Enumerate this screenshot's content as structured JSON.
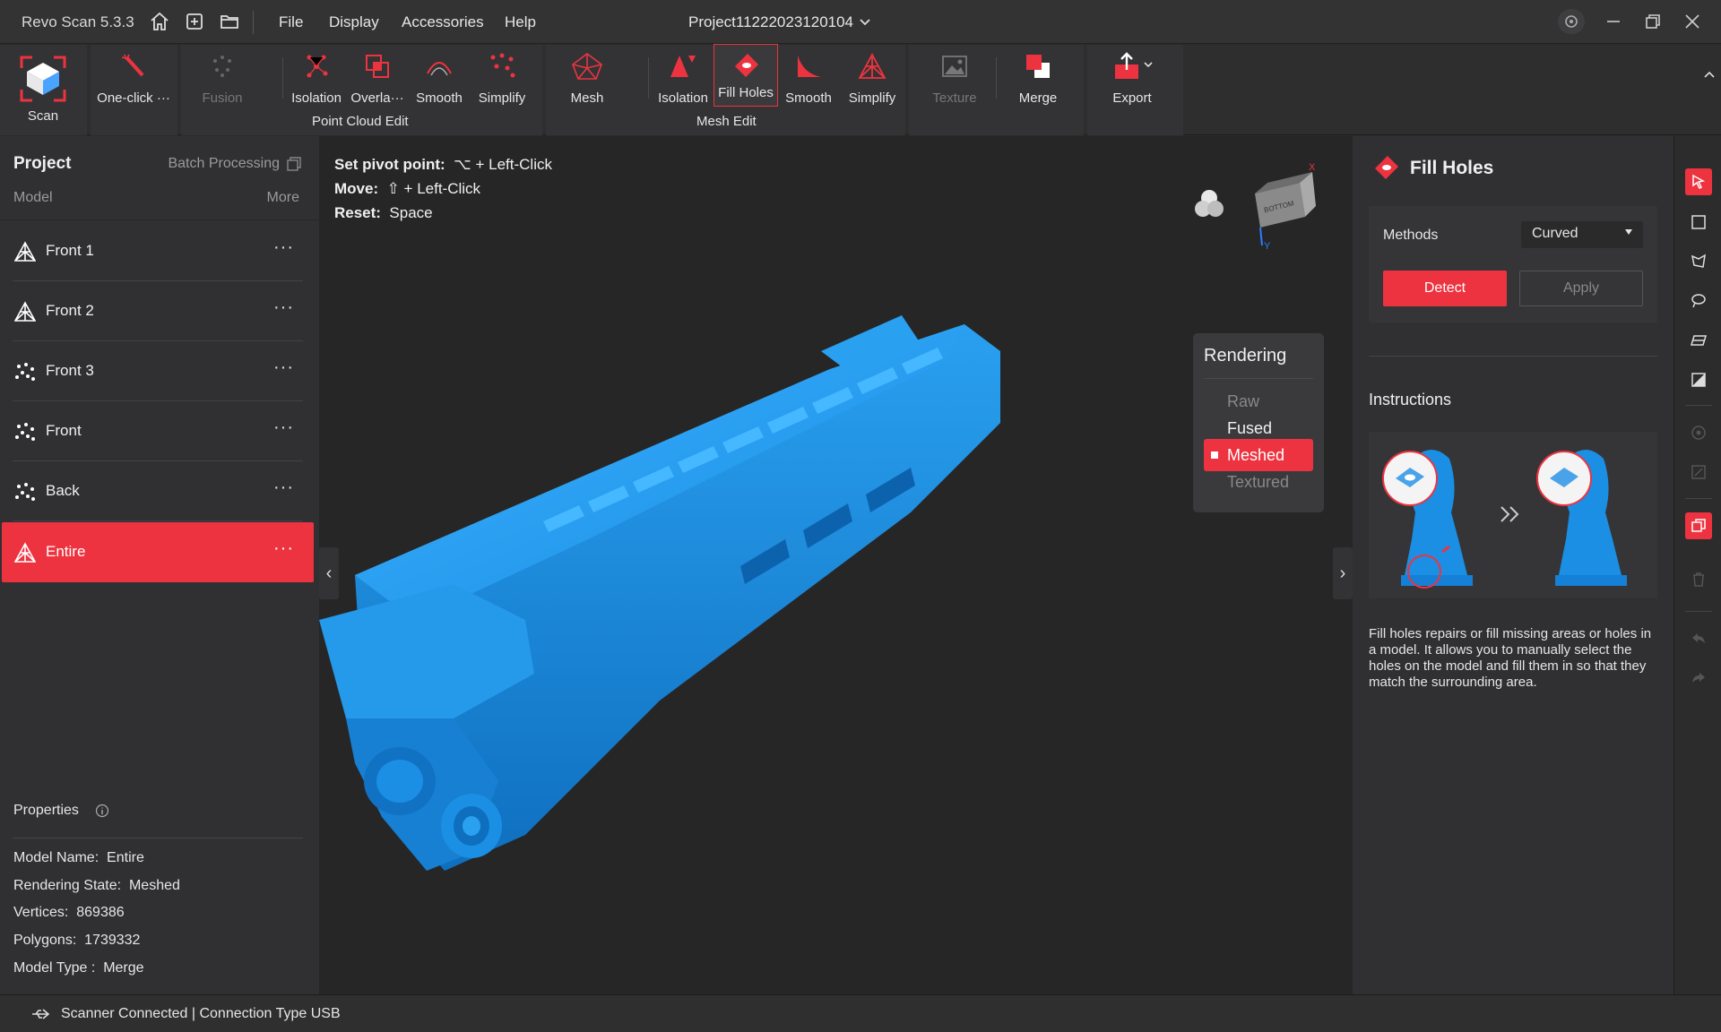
{
  "titlebar": {
    "app_name": "Revo Scan 5.3.3",
    "menu": [
      "File",
      "Display",
      "Accessories",
      "Help"
    ],
    "project_name": "Project11222023120104"
  },
  "ribbon": {
    "scan": "Scan",
    "one_click": "One-click ···",
    "fusion": "Fusion",
    "pc_isolation": "Isolation",
    "pc_overlap": "Overla···",
    "pc_smooth": "Smooth",
    "pc_simplify": "Simplify",
    "point_cloud_edit": "Point Cloud Edit",
    "mesh": "Mesh",
    "me_isolation": "Isolation",
    "me_fill_holes": "Fill Holes",
    "me_smooth": "Smooth",
    "me_simplify": "Simplify",
    "mesh_edit": "Mesh Edit",
    "texture": "Texture",
    "merge": "Merge",
    "export": "Export"
  },
  "left": {
    "project": "Project",
    "batch": "Batch Processing",
    "model": "Model",
    "more": "More",
    "models": [
      {
        "name": "Front 1",
        "type": "mesh"
      },
      {
        "name": "Front 2",
        "type": "mesh"
      },
      {
        "name": "Front 3",
        "type": "points"
      },
      {
        "name": "Front",
        "type": "points"
      },
      {
        "name": "Back",
        "type": "points"
      },
      {
        "name": "Entire",
        "type": "mesh"
      }
    ],
    "dots": "···",
    "properties": "Properties",
    "props": [
      {
        "label": "Model Name:",
        "value": "Entire"
      },
      {
        "label": "Rendering State:",
        "value": "Meshed"
      },
      {
        "label": "Vertices:",
        "value": "869386"
      },
      {
        "label": "Polygons:",
        "value": "1739332"
      },
      {
        "label": "Model Type :",
        "value": "Merge"
      }
    ]
  },
  "viewport": {
    "hint1_label": "Set pivot point:",
    "hint1_value": "⌥ + Left-Click",
    "hint2_label": "Move:",
    "hint2_value": "⇧ + Left-Click",
    "hint3_label": "Reset:",
    "hint3_value": "Space",
    "cube_face": "BOTTOM",
    "axis_x": "X",
    "axis_y": "Y",
    "rendering": {
      "title": "Rendering",
      "items": [
        "Raw",
        "Fused",
        "Meshed",
        "Textured"
      ],
      "active": "Meshed"
    },
    "model_color": "#1a8fe3"
  },
  "right": {
    "title": "Fill Holes",
    "methods_label": "Methods",
    "methods_value": "Curved",
    "detect": "Detect",
    "apply": "Apply",
    "instructions": "Instructions",
    "instr_text": "Fill holes repairs or fill missing areas or holes in a model. It allows you to manually select the holes on the model and fill them in so that they match the surrounding area."
  },
  "status": {
    "text": "Scanner Connected | Connection Type USB"
  },
  "colors": {
    "accent": "#ee3340",
    "mesh_blue": "#1a8fe3"
  }
}
